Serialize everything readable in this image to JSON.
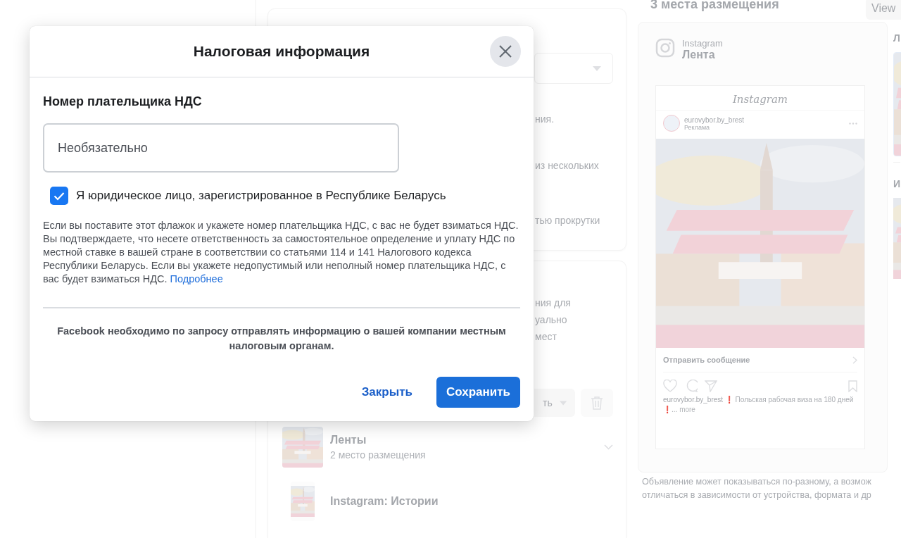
{
  "background": {
    "setup_card": {
      "fragments": [
        "ния.",
        "из нескольких",
        "тью прокрутки"
      ]
    },
    "options_card": {
      "fragments": [
        "ния для",
        "уально",
        "мест"
      ],
      "select_label": "ть",
      "placements": [
        {
          "kind": "feed",
          "title": "Ленты",
          "subtitle": "2 место размещения",
          "expandable": true
        },
        {
          "kind": "story",
          "title": "Instagram: Истории",
          "expandable": false
        }
      ]
    },
    "preview": {
      "title": "3 места размещения",
      "view_button": "View",
      "platform": "Instagram",
      "placement": "Лента",
      "wordmark": "Instagram",
      "account": "eurovybor.by_brest",
      "sponsored": "Реклама",
      "cta": "Отправить сообщение",
      "caption_account": "eurovybor.by_brest",
      "caption_text": "❗ Польская рабочая виза на 180 дней ❗...",
      "caption_more": "more",
      "side_labels": [
        "Л",
        "И"
      ]
    },
    "footer_note": [
      "Объявление может показываться по-разному, а возмож",
      "отличаться в зависимости от устройства, формата и др"
    ]
  },
  "dialog": {
    "title": "Налоговая информация",
    "field_label": "Номер плательщика НДС",
    "placeholder": "Необязательно",
    "checkbox": {
      "label": "Я юридическое лицо, зарегистрированное в Республике Беларусь",
      "checked": true
    },
    "description": "Если вы поставите этот флажок и укажете номер плательщика НДС, с вас не будет взиматься НДС. Вы подтверждаете, что несете ответственность за самостоятельное определение и уплату НДС по местной ставке в вашей стране в соответствии со статьями 114 и 141 Налогового кодекса Республики Беларусь. Если вы укажете недопустимый или неполный номер плательщика НДС, с вас будет взиматься НДС.",
    "link": "Подробнее",
    "notice": "Facebook необходимо по запросу отправлять информацию о вашей компании местным налоговым органам.",
    "buttons": [
      {
        "kind": "secondary",
        "label": "Закрыть"
      },
      {
        "kind": "primary",
        "label": "Сохранить"
      }
    ]
  }
}
